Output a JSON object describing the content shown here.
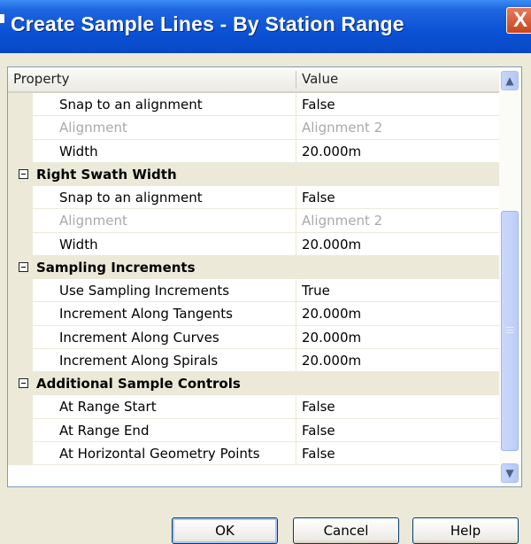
{
  "window": {
    "title": "Create Sample Lines - By Station Range",
    "close_label": "X"
  },
  "grid": {
    "columns": {
      "property": "Property",
      "value": "Value"
    },
    "rows": [
      {
        "kind": "prop",
        "label": "Snap to an alignment",
        "value": "False",
        "enabled": true
      },
      {
        "kind": "prop",
        "label": "Alignment",
        "value": "Alignment 2",
        "enabled": false
      },
      {
        "kind": "prop",
        "label": "Width",
        "value": "20.000m",
        "enabled": true
      },
      {
        "kind": "category",
        "label": "Right Swath Width",
        "value": ""
      },
      {
        "kind": "prop",
        "label": "Snap to an alignment",
        "value": "False",
        "enabled": true
      },
      {
        "kind": "prop",
        "label": "Alignment",
        "value": "Alignment 2",
        "enabled": false
      },
      {
        "kind": "prop",
        "label": "Width",
        "value": "20.000m",
        "enabled": true
      },
      {
        "kind": "category",
        "label": "Sampling Increments",
        "value": ""
      },
      {
        "kind": "prop",
        "label": "Use Sampling Increments",
        "value": "True",
        "enabled": true
      },
      {
        "kind": "prop",
        "label": "Increment Along Tangents",
        "value": "20.000m",
        "enabled": true
      },
      {
        "kind": "prop",
        "label": "Increment Along Curves",
        "value": "20.000m",
        "enabled": true
      },
      {
        "kind": "prop",
        "label": "Increment Along Spirals",
        "value": "20.000m",
        "enabled": true
      },
      {
        "kind": "category",
        "label": "Additional Sample Controls",
        "value": ""
      },
      {
        "kind": "prop",
        "label": "At Range Start",
        "value": "False",
        "enabled": true
      },
      {
        "kind": "prop",
        "label": "At Range End",
        "value": "False",
        "enabled": true
      },
      {
        "kind": "prop",
        "label": "At Horizontal Geometry Points",
        "value": "False",
        "enabled": true
      }
    ]
  },
  "buttons": {
    "ok": "OK",
    "cancel": "Cancel",
    "help": "Help"
  },
  "colors": {
    "titlebar": "#0a52d6",
    "dialog_bg": "#ece9d8",
    "disabled_text": "#a9a9a9",
    "close_button": "#d8582f"
  }
}
